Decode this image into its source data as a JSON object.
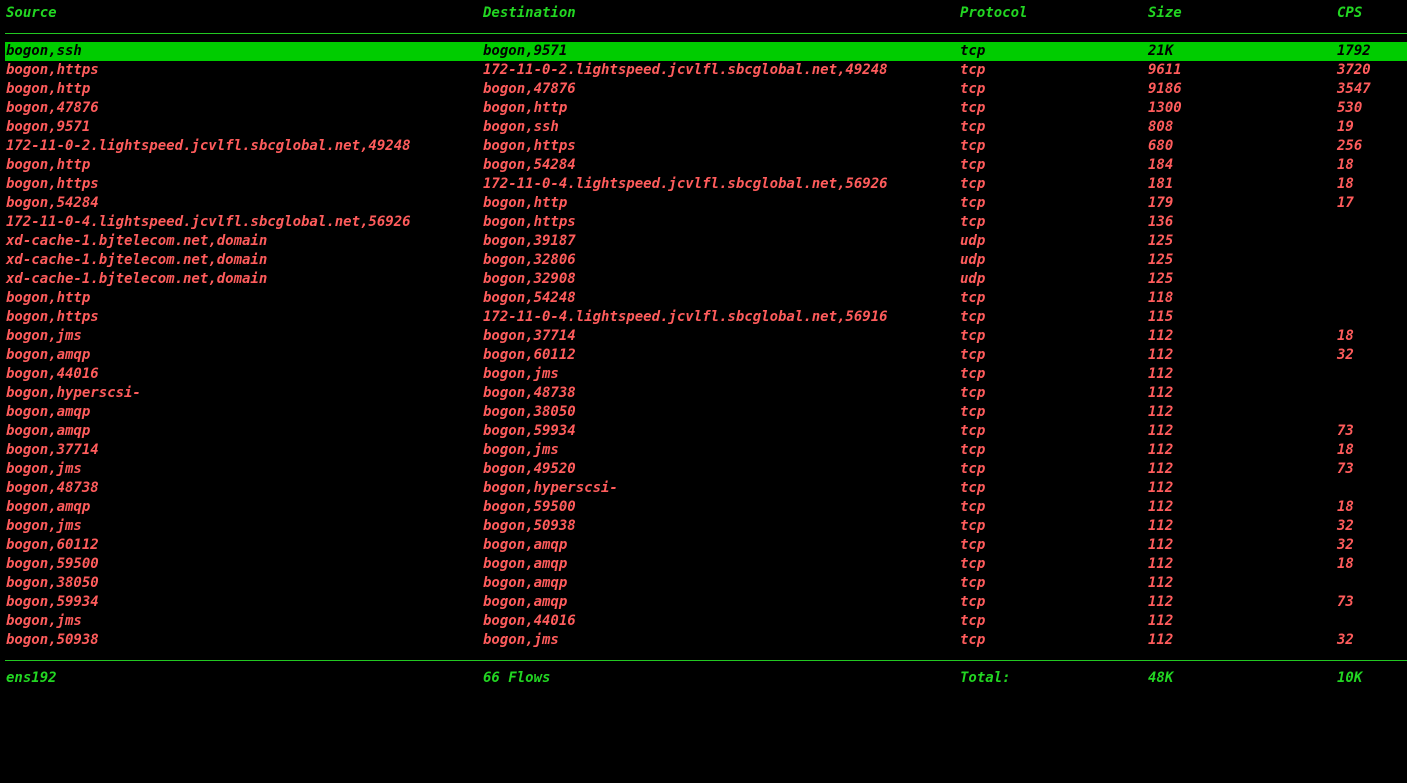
{
  "colors": {
    "background": "#000000",
    "header_text": "#22d622",
    "row_text": "#ff5c5c",
    "selected_bg": "#00cc00",
    "selected_text": "#000000"
  },
  "header": {
    "source": "Source",
    "destination": "Destination",
    "protocol": "Protocol",
    "size": "Size",
    "cps": "CPS"
  },
  "flows": [
    {
      "source": "bogon,ssh",
      "destination": "bogon,9571",
      "protocol": "tcp",
      "size": "21K",
      "cps": "1792",
      "selected": true
    },
    {
      "source": "bogon,https",
      "destination": "172-11-0-2.lightspeed.jcvlfl.sbcglobal.net,49248",
      "protocol": "tcp",
      "size": "9611",
      "cps": "3720"
    },
    {
      "source": "bogon,http",
      "destination": "bogon,47876",
      "protocol": "tcp",
      "size": "9186",
      "cps": "3547"
    },
    {
      "source": "bogon,47876",
      "destination": "bogon,http",
      "protocol": "tcp",
      "size": "1300",
      "cps": "530"
    },
    {
      "source": "bogon,9571",
      "destination": "bogon,ssh",
      "protocol": "tcp",
      "size": "808",
      "cps": "19"
    },
    {
      "source": "172-11-0-2.lightspeed.jcvlfl.sbcglobal.net,49248",
      "destination": "bogon,https",
      "protocol": "tcp",
      "size": "680",
      "cps": "256"
    },
    {
      "source": "bogon,http",
      "destination": "bogon,54284",
      "protocol": "tcp",
      "size": "184",
      "cps": "18"
    },
    {
      "source": "bogon,https",
      "destination": "172-11-0-4.lightspeed.jcvlfl.sbcglobal.net,56926",
      "protocol": "tcp",
      "size": "181",
      "cps": "18"
    },
    {
      "source": "bogon,54284",
      "destination": "bogon,http",
      "protocol": "tcp",
      "size": "179",
      "cps": "17"
    },
    {
      "source": "172-11-0-4.lightspeed.jcvlfl.sbcglobal.net,56926",
      "destination": "bogon,https",
      "protocol": "tcp",
      "size": "136",
      "cps": ""
    },
    {
      "source": "xd-cache-1.bjtelecom.net,domain",
      "destination": "bogon,39187",
      "protocol": "udp",
      "size": "125",
      "cps": ""
    },
    {
      "source": "xd-cache-1.bjtelecom.net,domain",
      "destination": "bogon,32806",
      "protocol": "udp",
      "size": "125",
      "cps": ""
    },
    {
      "source": "xd-cache-1.bjtelecom.net,domain",
      "destination": "bogon,32908",
      "protocol": "udp",
      "size": "125",
      "cps": ""
    },
    {
      "source": "bogon,http",
      "destination": "bogon,54248",
      "protocol": "tcp",
      "size": "118",
      "cps": ""
    },
    {
      "source": "bogon,https",
      "destination": "172-11-0-4.lightspeed.jcvlfl.sbcglobal.net,56916",
      "protocol": "tcp",
      "size": "115",
      "cps": ""
    },
    {
      "source": "bogon,jms",
      "destination": "bogon,37714",
      "protocol": "tcp",
      "size": "112",
      "cps": "18"
    },
    {
      "source": "bogon,amqp",
      "destination": "bogon,60112",
      "protocol": "tcp",
      "size": "112",
      "cps": "32"
    },
    {
      "source": "bogon,44016",
      "destination": "bogon,jms",
      "protocol": "tcp",
      "size": "112",
      "cps": ""
    },
    {
      "source": "bogon,hyperscsi-",
      "destination": "bogon,48738",
      "protocol": "tcp",
      "size": "112",
      "cps": ""
    },
    {
      "source": "bogon,amqp",
      "destination": "bogon,38050",
      "protocol": "tcp",
      "size": "112",
      "cps": ""
    },
    {
      "source": "bogon,amqp",
      "destination": "bogon,59934",
      "protocol": "tcp",
      "size": "112",
      "cps": "73"
    },
    {
      "source": "bogon,37714",
      "destination": "bogon,jms",
      "protocol": "tcp",
      "size": "112",
      "cps": "18"
    },
    {
      "source": "bogon,jms",
      "destination": "bogon,49520",
      "protocol": "tcp",
      "size": "112",
      "cps": "73"
    },
    {
      "source": "bogon,48738",
      "destination": "bogon,hyperscsi-",
      "protocol": "tcp",
      "size": "112",
      "cps": ""
    },
    {
      "source": "bogon,amqp",
      "destination": "bogon,59500",
      "protocol": "tcp",
      "size": "112",
      "cps": "18"
    },
    {
      "source": "bogon,jms",
      "destination": "bogon,50938",
      "protocol": "tcp",
      "size": "112",
      "cps": "32"
    },
    {
      "source": "bogon,60112",
      "destination": "bogon,amqp",
      "protocol": "tcp",
      "size": "112",
      "cps": "32"
    },
    {
      "source": "bogon,59500",
      "destination": "bogon,amqp",
      "protocol": "tcp",
      "size": "112",
      "cps": "18"
    },
    {
      "source": "bogon,38050",
      "destination": "bogon,amqp",
      "protocol": "tcp",
      "size": "112",
      "cps": ""
    },
    {
      "source": "bogon,59934",
      "destination": "bogon,amqp",
      "protocol": "tcp",
      "size": "112",
      "cps": "73"
    },
    {
      "source": "bogon,jms",
      "destination": "bogon,44016",
      "protocol": "tcp",
      "size": "112",
      "cps": ""
    },
    {
      "source": "bogon,50938",
      "destination": "bogon,jms",
      "protocol": "tcp",
      "size": "112",
      "cps": "32"
    }
  ],
  "footer": {
    "interface": "ens192",
    "flows": "66 Flows",
    "total_label": "Total:",
    "total_size": "48K",
    "total_cps": "10K"
  }
}
